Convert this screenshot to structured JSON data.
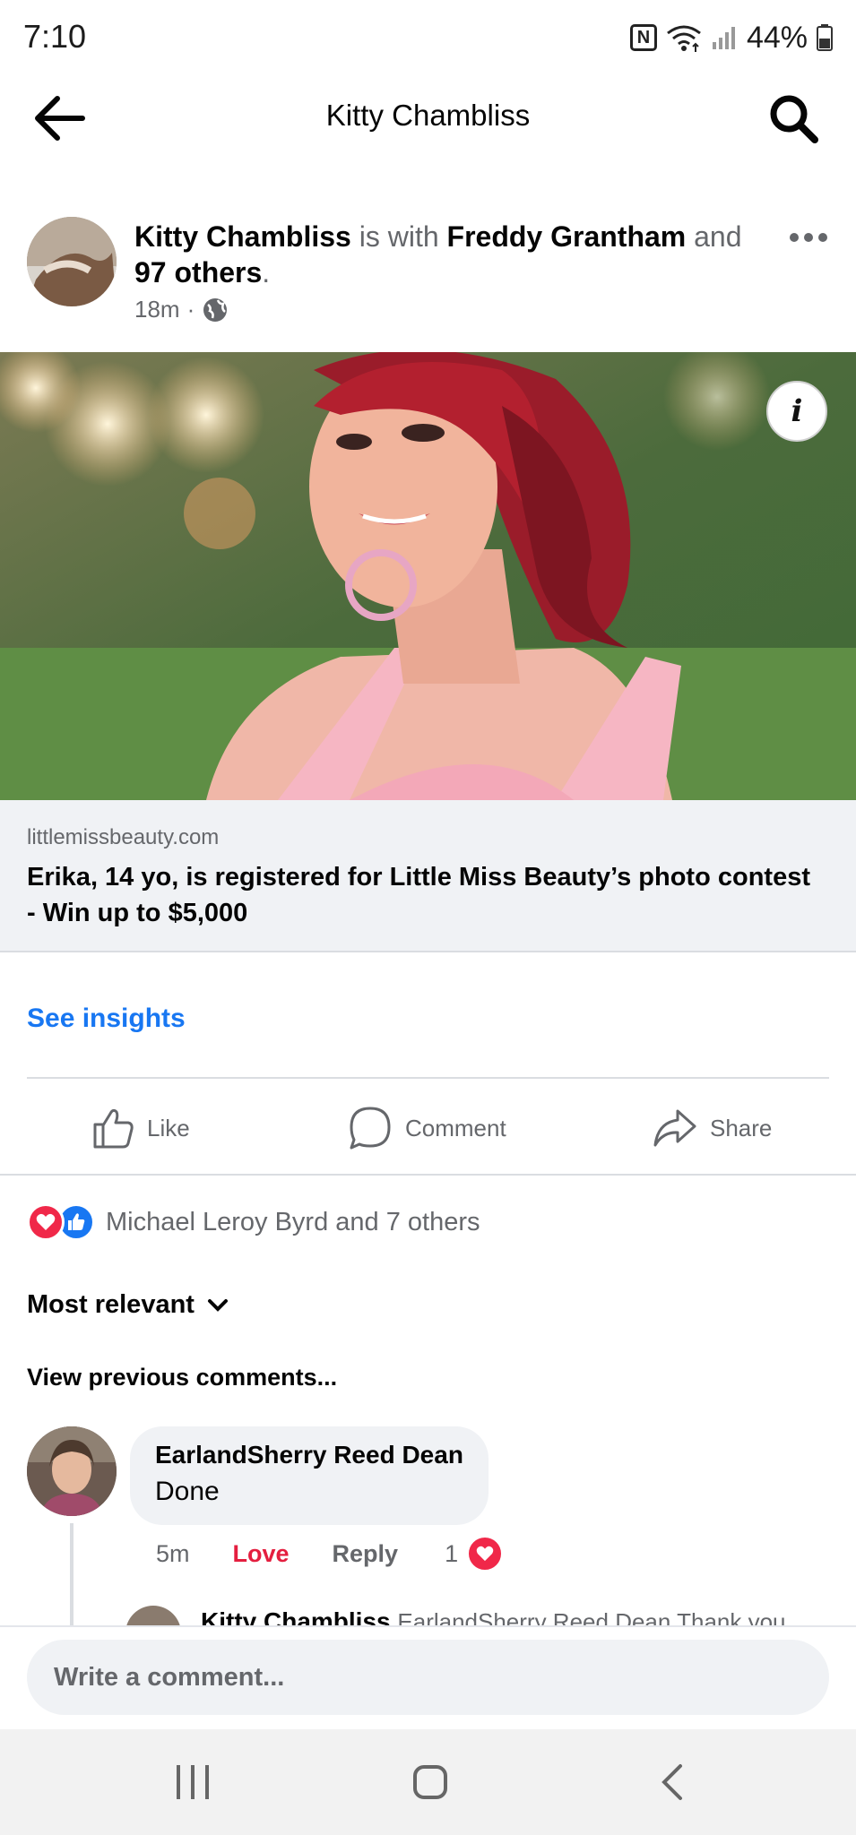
{
  "status_bar": {
    "time": "7:10",
    "battery": "44%"
  },
  "top_bar": {
    "title": "Kitty Chambliss"
  },
  "post": {
    "author": "Kitty Chambliss",
    "with_text": "is with",
    "tagged": "Freddy Grantham",
    "and_text": "and",
    "others_count": "97",
    "others_word": "others",
    "time": "18m",
    "separator": "·"
  },
  "link_preview": {
    "domain": "littlemissbeauty.com",
    "title": "Erika, 14 yo, is registered for Little Miss Beauty’s photo contest - Win up to $5,000"
  },
  "insights": {
    "label": "See insights"
  },
  "actions": {
    "like": "Like",
    "comment": "Comment",
    "share": "Share"
  },
  "reactions": {
    "text": "Michael Leroy Byrd and 7 others"
  },
  "comments_section": {
    "sort_label": "Most relevant",
    "view_previous": "View previous comments..."
  },
  "comment": {
    "author": "EarlandSherry Reed Dean",
    "text": "Done",
    "time": "5m",
    "love_label": "Love",
    "reply_label": "Reply",
    "reaction_count": "1"
  },
  "reply_peek": {
    "author": "Kitty Chambliss",
    "text": "EarlandSherry Reed Dean Thank you"
  },
  "composer": {
    "placeholder": "Write a comment..."
  },
  "colors": {
    "accent": "#1877f2",
    "love": "#f02849",
    "love_text": "#e41e3f",
    "secondary_text": "#65676b"
  }
}
